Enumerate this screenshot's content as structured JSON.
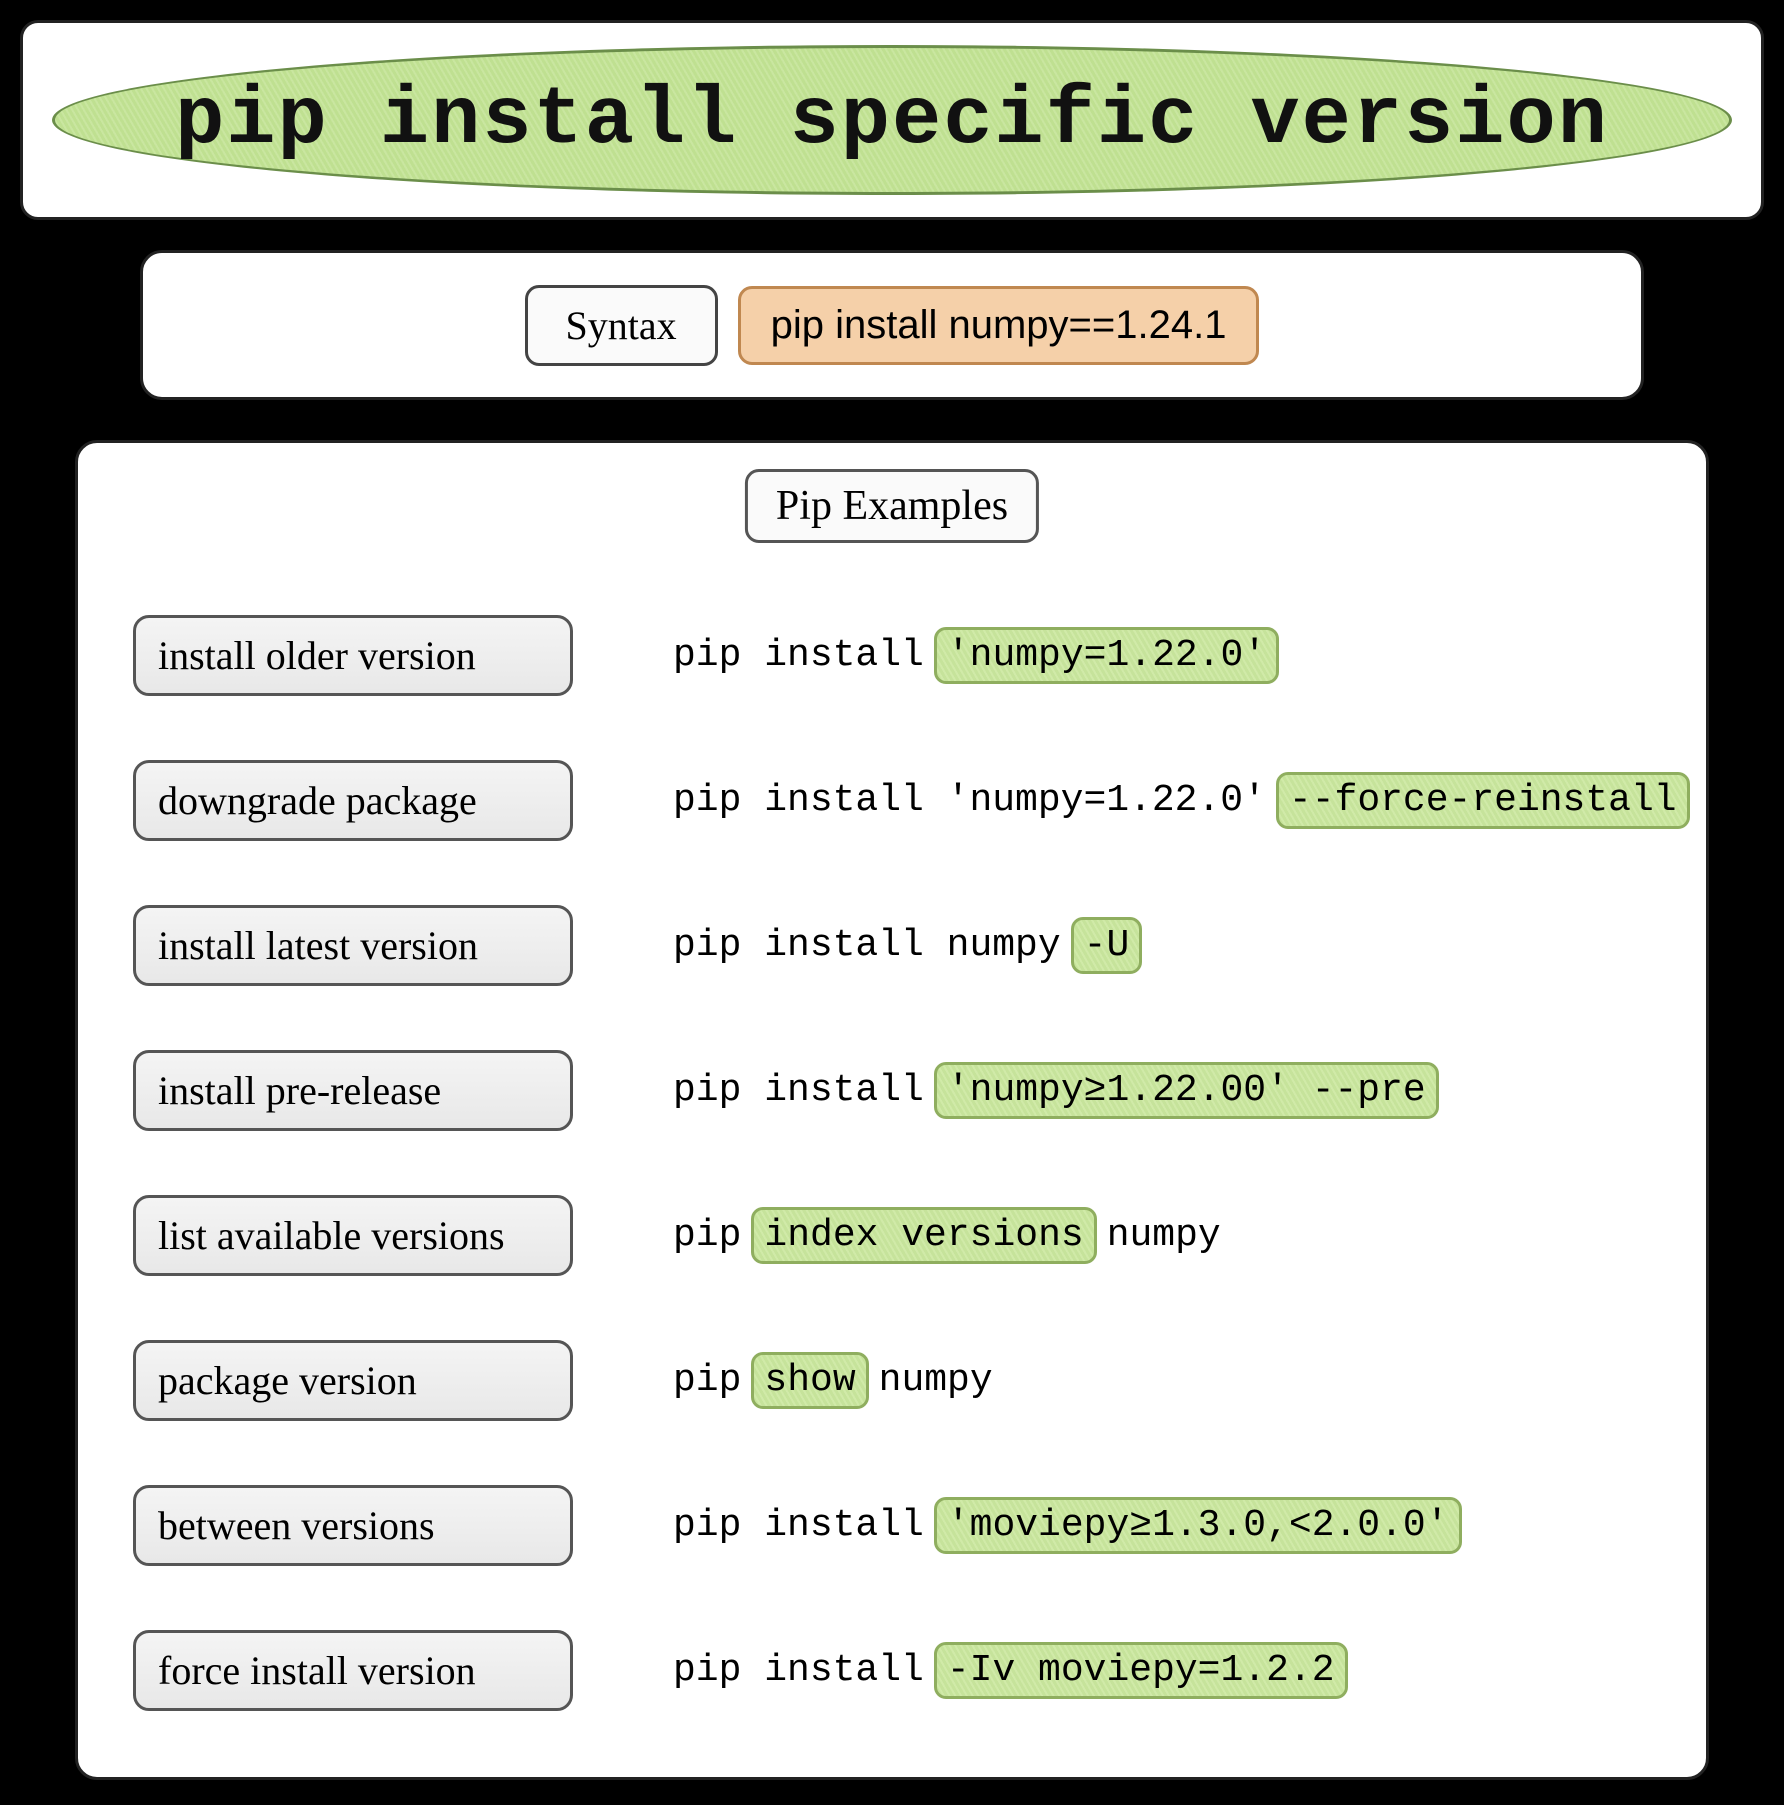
{
  "header": {
    "title": "pip install specific version"
  },
  "syntax": {
    "label": "Syntax",
    "example": "pip install numpy==1.24.1"
  },
  "section_title": "Pip Examples",
  "examples": [
    {
      "label": "install older version",
      "prefix": "pip install ",
      "highlight": "'numpy=1.22.0'",
      "suffix": ""
    },
    {
      "label": "downgrade package",
      "prefix": "pip install 'numpy=1.22.0'",
      "highlight": "--force-reinstall",
      "suffix": ""
    },
    {
      "label": "install latest version",
      "prefix": "pip install numpy ",
      "highlight": "-U",
      "suffix": ""
    },
    {
      "label": "install pre-release",
      "prefix": "pip install ",
      "highlight": "'numpy≥1.22.00' --pre",
      "suffix": ""
    },
    {
      "label": "list available versions",
      "prefix": "pip ",
      "highlight": "index versions",
      "suffix": " numpy"
    },
    {
      "label": "package version",
      "prefix": "pip ",
      "highlight": "show",
      "suffix": " numpy"
    },
    {
      "label": "between versions",
      "prefix": "pip install ",
      "highlight": "'moviepy≥1.3.0,<2.0.0'",
      "suffix": ""
    },
    {
      "label": "force install version",
      "prefix": "pip install ",
      "highlight": "-Iv moviepy=1.2.2",
      "suffix": ""
    }
  ]
}
